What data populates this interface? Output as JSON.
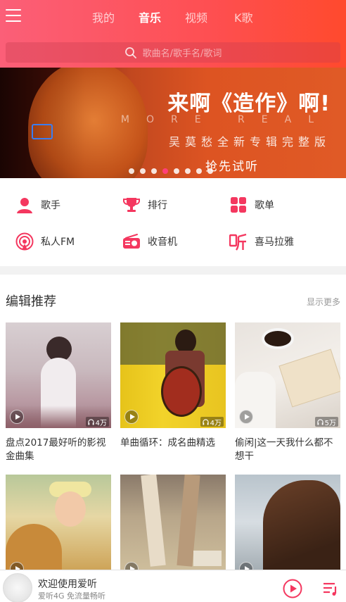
{
  "header": {
    "tabs": [
      {
        "label": "我的"
      },
      {
        "label": "音乐"
      },
      {
        "label": "视频"
      },
      {
        "label": "K歌"
      }
    ],
    "active_tab": "音乐",
    "search_placeholder": "歌曲名/歌手名/歌词",
    "accent": "#fe4f52"
  },
  "banner": {
    "title": "来啊《造作》啊!",
    "subtitle_en": "MORE REAL",
    "subtitle": "吴莫愁全新专辑完整版",
    "cta": "抢先试听",
    "dot_count": 8,
    "active_dot_index": 3
  },
  "categories": [
    {
      "label": "歌手",
      "icon": "singer-icon"
    },
    {
      "label": "排行",
      "icon": "trophy-icon"
    },
    {
      "label": "歌单",
      "icon": "playlist-grid-icon"
    },
    {
      "label": "私人FM",
      "icon": "radio-wave-icon"
    },
    {
      "label": "收音机",
      "icon": "radio-icon"
    },
    {
      "label": "喜马拉雅",
      "icon": "ting-icon"
    }
  ],
  "section": {
    "title": "编辑推荐",
    "more": "显示更多",
    "cards": [
      {
        "title": "盘点2017最好听的影视金曲集",
        "plays": "4万"
      },
      {
        "title": "单曲循环：成名曲精选",
        "plays": "4万"
      },
      {
        "title": "偷闲|这一天我什么都不想干",
        "plays": "5万"
      },
      {
        "title": "",
        "plays": ""
      },
      {
        "title": "",
        "plays": ""
      },
      {
        "title": "",
        "plays": ""
      }
    ]
  },
  "player": {
    "title": "欢迎使用爱听",
    "subtitle": "爱听4G 免流量畅听"
  }
}
